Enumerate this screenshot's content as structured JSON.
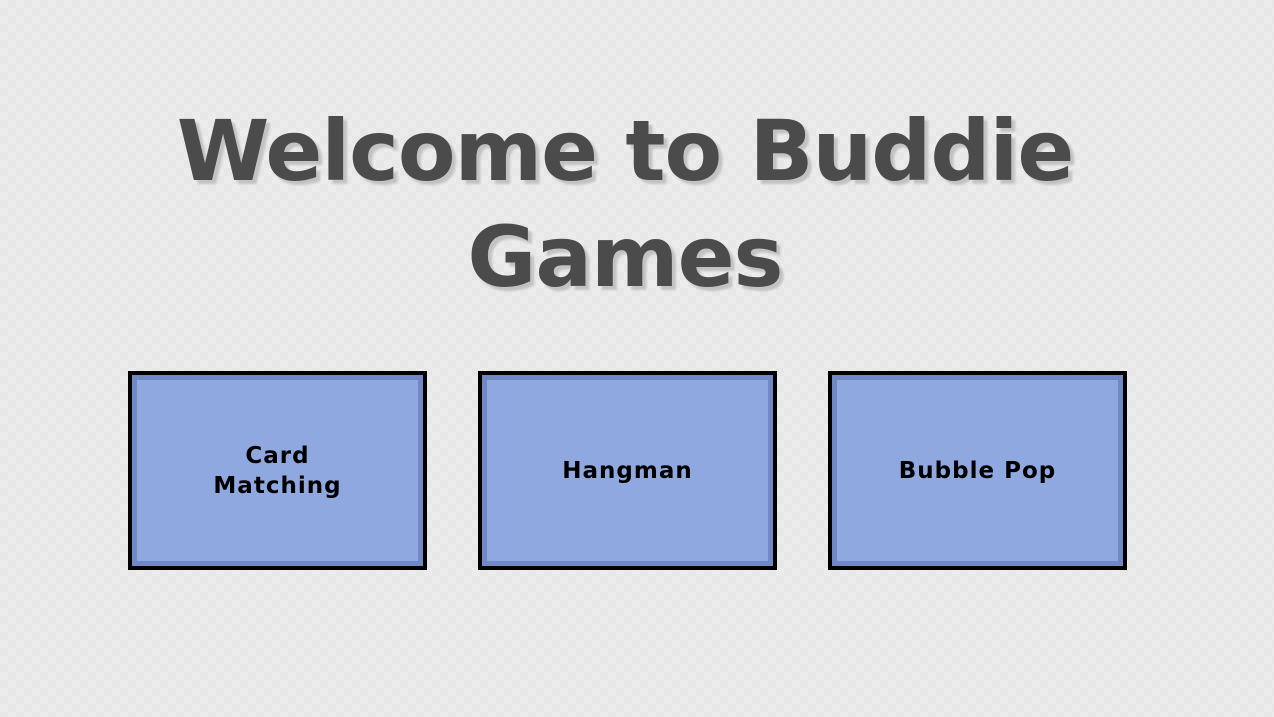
{
  "title": "Welcome to Buddie Games",
  "games": [
    {
      "label": "Card Matching"
    },
    {
      "label": "Hangman"
    },
    {
      "label": "Bubble Pop"
    }
  ],
  "colors": {
    "background": "#ececec",
    "title_text": "#4b4b4b",
    "button_fill": "#90a8e0",
    "button_inner_border": "#7088c4",
    "button_border": "#000000"
  }
}
